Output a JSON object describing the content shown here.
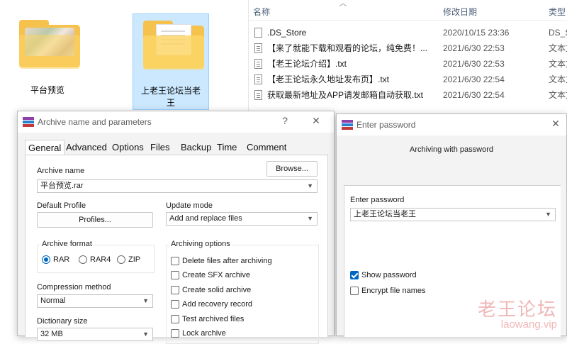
{
  "explorer": {
    "folders": [
      {
        "label": "平台预览",
        "icon": "folder-photo-icon"
      },
      {
        "label": "上老王论坛当老王",
        "icon": "folder-document-icon"
      }
    ],
    "columns": {
      "name": "名称",
      "modified": "修改日期",
      "type": "类型"
    },
    "files": [
      {
        "name": ".DS_Store",
        "date": "2020/10/15 23:36",
        "type": "DS_S",
        "icon": "file-icon"
      },
      {
        "name": "【来了就能下载和观看的论坛，纯免费！...",
        "date": "2021/6/30 22:53",
        "type": "文本文",
        "icon": "text-file-icon"
      },
      {
        "name": "【老王论坛介绍】.txt",
        "date": "2021/6/30 22:53",
        "type": "文本文",
        "icon": "text-file-icon"
      },
      {
        "name": "【老王论坛永久地址发布页】.txt",
        "date": "2021/6/30 22:54",
        "type": "文本文",
        "icon": "text-file-icon"
      },
      {
        "name": "获取最新地址及APP请发邮箱自动获取.txt",
        "date": "2021/6/30 22:54",
        "type": "文本文",
        "icon": "text-file-icon"
      }
    ]
  },
  "archive_dialog": {
    "title": "Archive name and parameters",
    "help": "?",
    "close": "✕",
    "tabs": [
      "General",
      "Advanced",
      "Options",
      "Files",
      "Backup",
      "Time",
      "Comment"
    ],
    "active_tab": "General",
    "archive_name_label": "Archive name",
    "browse_label": "Browse...",
    "archive_name_value": "平台预览.rar",
    "default_profile_label": "Default Profile",
    "profiles_label": "Profiles...",
    "update_mode_label": "Update mode",
    "update_mode_value": "Add and replace files",
    "archive_format_label": "Archive format",
    "formats": [
      {
        "label": "RAR",
        "selected": true
      },
      {
        "label": "RAR4",
        "selected": false
      },
      {
        "label": "ZIP",
        "selected": false
      }
    ],
    "archiving_options_label": "Archiving options",
    "options": [
      {
        "label": "Delete files after archiving",
        "checked": false
      },
      {
        "label": "Create SFX archive",
        "checked": false
      },
      {
        "label": "Create solid archive",
        "checked": false
      },
      {
        "label": "Add recovery record",
        "checked": false
      },
      {
        "label": "Test archived files",
        "checked": false
      },
      {
        "label": "Lock archive",
        "checked": false
      }
    ],
    "compression_method_label": "Compression method",
    "compression_method_value": "Normal",
    "dictionary_size_label": "Dictionary size",
    "dictionary_size_value": "32 MB"
  },
  "password_dialog": {
    "title": "Enter password",
    "close": "✕",
    "heading": "Archiving with password",
    "enter_password_label": "Enter password",
    "password_value": "上老王论坛当老王",
    "show_password_label": "Show password",
    "show_password_checked": true,
    "encrypt_names_label": "Encrypt file names",
    "encrypt_names_checked": false
  },
  "watermark": {
    "main": "老王论坛",
    "sub": "laowang.vip"
  },
  "colors": {
    "accent": "#0067c0",
    "selection": "#cce8ff",
    "folder": "#fcd667",
    "watermark": "#f0b7b7"
  }
}
